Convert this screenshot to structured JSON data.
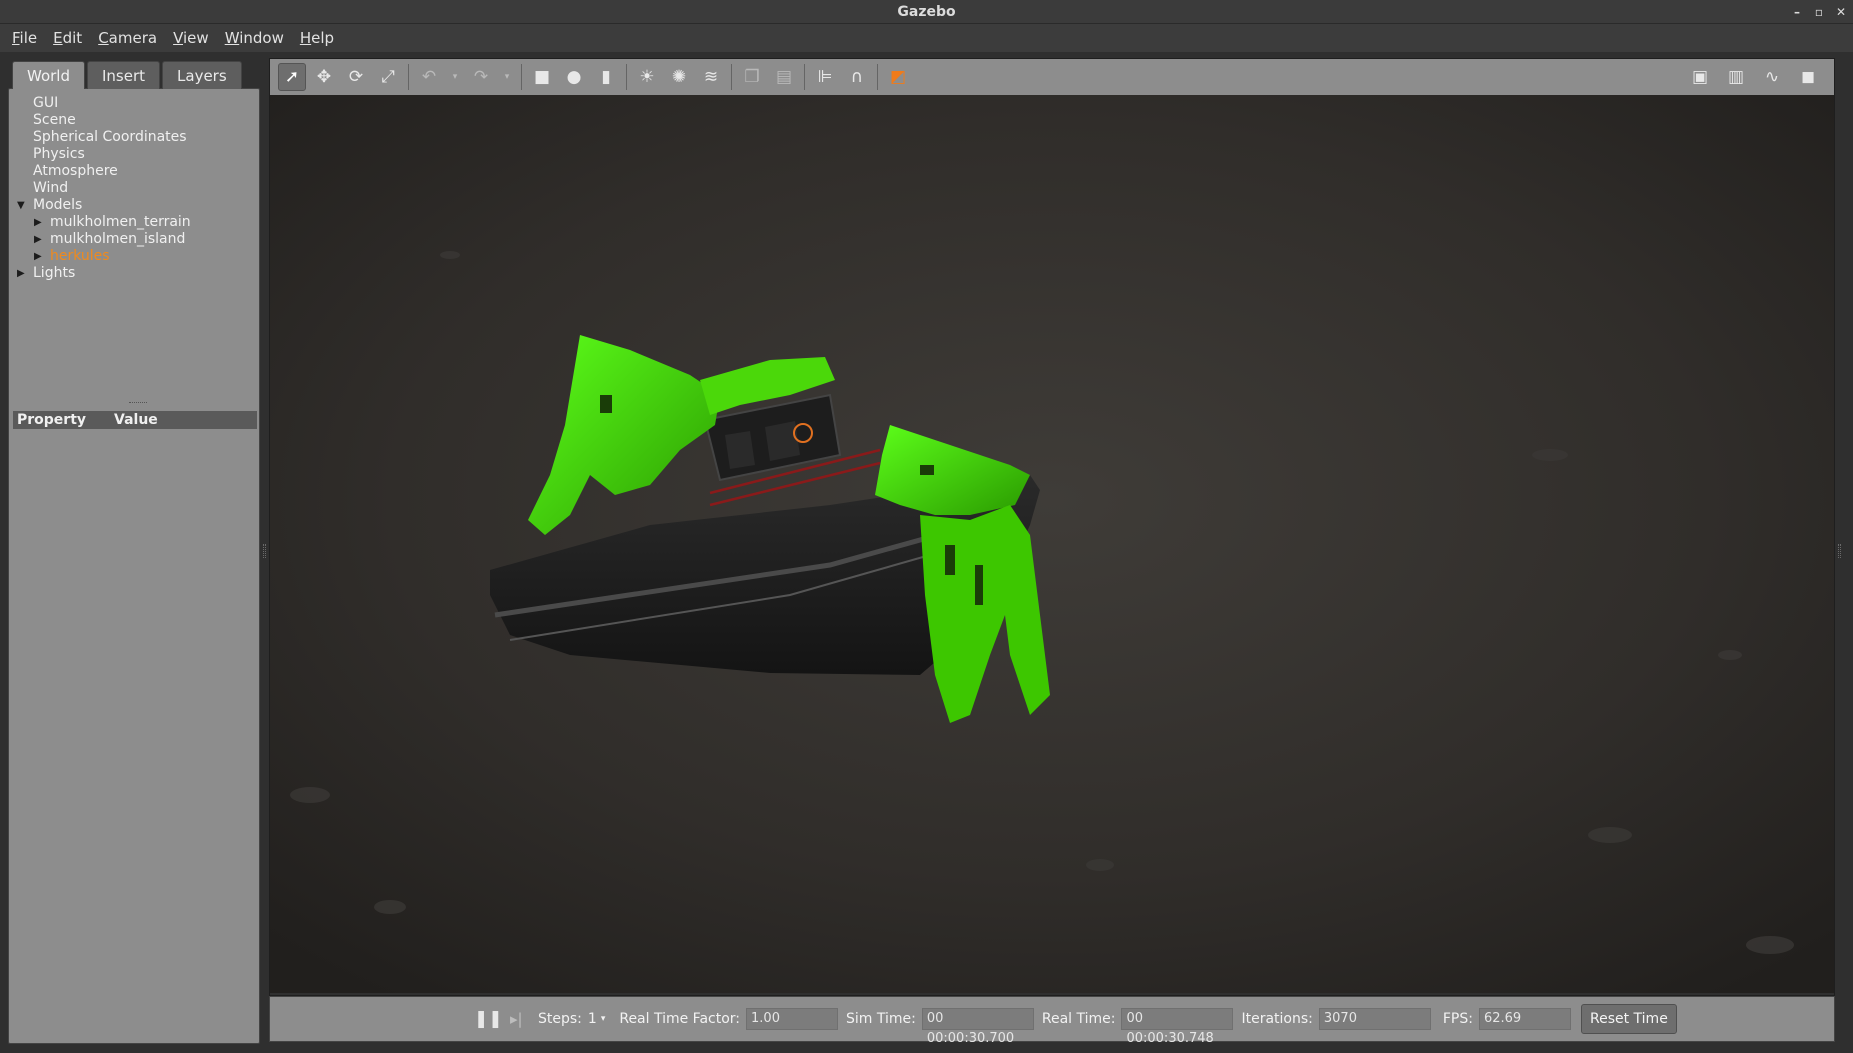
{
  "window": {
    "title": "Gazebo",
    "controls": [
      "–",
      "▫",
      "✕"
    ]
  },
  "menubar": {
    "items": [
      {
        "first": "F",
        "rest": "ile"
      },
      {
        "first": "E",
        "rest": "dit"
      },
      {
        "first": "C",
        "rest": "amera"
      },
      {
        "first": "V",
        "rest": "iew"
      },
      {
        "first": "W",
        "rest": "indow"
      },
      {
        "first": "H",
        "rest": "elp"
      }
    ]
  },
  "leftpanel": {
    "tabs": [
      "World",
      "Insert",
      "Layers"
    ],
    "active_tab": "World",
    "tree": [
      {
        "label": "GUI",
        "level": 0,
        "arrow": ""
      },
      {
        "label": "Scene",
        "level": 0,
        "arrow": ""
      },
      {
        "label": "Spherical Coordinates",
        "level": 0,
        "arrow": ""
      },
      {
        "label": "Physics",
        "level": 0,
        "arrow": ""
      },
      {
        "label": "Atmosphere",
        "level": 0,
        "arrow": ""
      },
      {
        "label": "Wind",
        "level": 0,
        "arrow": ""
      },
      {
        "label": "Models",
        "level": 0,
        "arrow": "expanded"
      },
      {
        "label": "mulkholmen_terrain",
        "level": 1,
        "arrow": "collapsed"
      },
      {
        "label": "mulkholmen_island",
        "level": 1,
        "arrow": "collapsed"
      },
      {
        "label": "herkules",
        "level": 1,
        "arrow": "collapsed",
        "selected": true
      },
      {
        "label": "Lights",
        "level": 0,
        "arrow": "collapsed"
      }
    ],
    "properties": {
      "col_property": "Property",
      "col_value": "Value"
    }
  },
  "toolbar": {
    "tools": [
      {
        "name": "select-mode-icon",
        "glyph": "➚",
        "active": true
      },
      {
        "name": "translate-mode-icon",
        "glyph": "✥"
      },
      {
        "name": "rotate-mode-icon",
        "glyph": "⟳"
      },
      {
        "name": "scale-mode-icon",
        "glyph": "⤢"
      },
      {
        "sep": true
      },
      {
        "name": "undo-icon",
        "glyph": "↶",
        "dim": true
      },
      {
        "name": "undo-dropdown-icon",
        "glyph": "▾",
        "dim": true,
        "small": true
      },
      {
        "name": "redo-icon",
        "glyph": "↷",
        "dim": true
      },
      {
        "name": "redo-dropdown-icon",
        "glyph": "▾",
        "dim": true,
        "small": true
      },
      {
        "sep": true
      },
      {
        "name": "box-shape-icon",
        "glyph": "■"
      },
      {
        "name": "sphere-shape-icon",
        "glyph": "●"
      },
      {
        "name": "cylinder-shape-icon",
        "glyph": "▮"
      },
      {
        "sep": true
      },
      {
        "name": "point-light-icon",
        "glyph": "☀"
      },
      {
        "name": "spot-light-icon",
        "glyph": "✺"
      },
      {
        "name": "directional-light-icon",
        "glyph": "≋"
      },
      {
        "sep": true
      },
      {
        "name": "copy-icon",
        "glyph": "❐",
        "dim": true
      },
      {
        "name": "paste-icon",
        "glyph": "▤",
        "dim": true
      },
      {
        "sep": true
      },
      {
        "name": "align-icon",
        "glyph": "⊫"
      },
      {
        "name": "snap-icon",
        "glyph": "∩"
      },
      {
        "sep": true
      },
      {
        "name": "view-angle-icon",
        "glyph": "◩",
        "color": "#f07b1a"
      }
    ],
    "right_tools": [
      {
        "name": "screenshot-icon",
        "glyph": "▣"
      },
      {
        "name": "log-icon",
        "glyph": "▥"
      },
      {
        "name": "plot-icon",
        "glyph": "∿"
      },
      {
        "name": "record-video-icon",
        "glyph": "◼"
      }
    ]
  },
  "bottombar": {
    "steps_label": "Steps:",
    "steps_value": "1",
    "rtf_label": "Real Time Factor:",
    "rtf_value": "1.00",
    "sim_time_label": "Sim Time:",
    "sim_time_value": "00 00:00:30.700",
    "real_time_label": "Real Time:",
    "real_time_value": "00 00:00:30.748",
    "iterations_label": "Iterations:",
    "iterations_value": "3070",
    "fps_label": "FPS:",
    "fps_value": "62.69",
    "reset_label": "Reset Time"
  },
  "colors": {
    "selection_orange": "#f08a1d",
    "panel_gray": "#8d8d8d",
    "hull_dark": "#1f1f1f",
    "mesh_green": "#43d600"
  }
}
